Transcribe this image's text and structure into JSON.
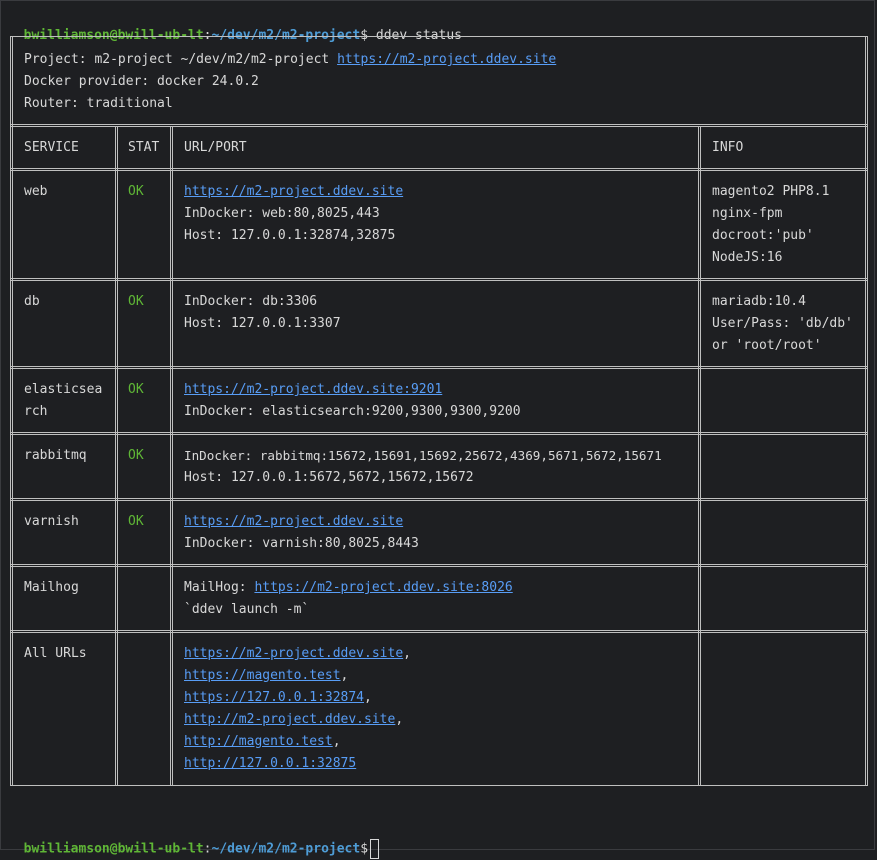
{
  "prompt": {
    "user_host": "bwilliamson@bwill-ub-lt",
    "sep": ":",
    "path": "~/dev/m2/m2-project",
    "dollar": "$",
    "command": " ddev status"
  },
  "status": {
    "project_label": "Project: m2-project ~/dev/m2/m2-project ",
    "project_url": "https://m2-project.ddev.site",
    "docker_provider": "Docker provider: docker 24.0.2",
    "router": "Router: traditional"
  },
  "headers": {
    "service": "SERVICE",
    "stat": "STAT",
    "url_port": "URL/PORT",
    "info": "INFO"
  },
  "rows": {
    "web": {
      "service": "web",
      "stat": "OK",
      "url": "https://m2-project.ddev.site",
      "indocker": "InDocker: web:80,8025,443",
      "host": "Host: 127.0.0.1:32874,32875",
      "info1": "magento2 PHP8.1",
      "info2": "nginx-fpm",
      "info3": "docroot:'pub'",
      "info4": "NodeJS:16"
    },
    "db": {
      "service": "db",
      "stat": "OK",
      "indocker": "InDocker: db:3306",
      "host": "Host: 127.0.0.1:3307",
      "info1": "mariadb:10.4",
      "info2": "User/Pass: 'db/db'",
      "info3": "or 'root/root'"
    },
    "elasticsearch": {
      "service1": "elasticsea",
      "service2": "rch",
      "stat": "OK",
      "url": "https://m2-project.ddev.site:9201",
      "indocker": "InDocker: elasticsearch:9200,9300,9300,9200"
    },
    "rabbitmq": {
      "service": "rabbitmq",
      "stat": "OK",
      "indocker": "InDocker: rabbitmq:15672,15691,15692,25672,4369,5671,5672,15671",
      "host": "Host: 127.0.0.1:5672,5672,15672,15672"
    },
    "varnish": {
      "service": "varnish",
      "stat": "OK",
      "url": "https://m2-project.ddev.site",
      "indocker": "InDocker: varnish:80,8025,8443"
    },
    "mailhog": {
      "service": "Mailhog",
      "label": "MailHog: ",
      "url": "https://m2-project.ddev.site:8026",
      "launch": "`ddev launch -m`"
    },
    "all_urls": {
      "service": "All URLs",
      "urls": [
        "https://m2-project.ddev.site",
        "https://magento.test",
        "https://127.0.0.1:32874",
        "http://m2-project.ddev.site",
        "http://magento.test",
        "http://127.0.0.1:32875"
      ],
      "comma": ","
    }
  },
  "colors": {
    "background": "#1e1f22",
    "user_green": "#5fb636",
    "path_blue": "#4e9cd6",
    "link_blue": "#589df6",
    "text": "#d8d8d8",
    "border": "#bfbfbf"
  }
}
